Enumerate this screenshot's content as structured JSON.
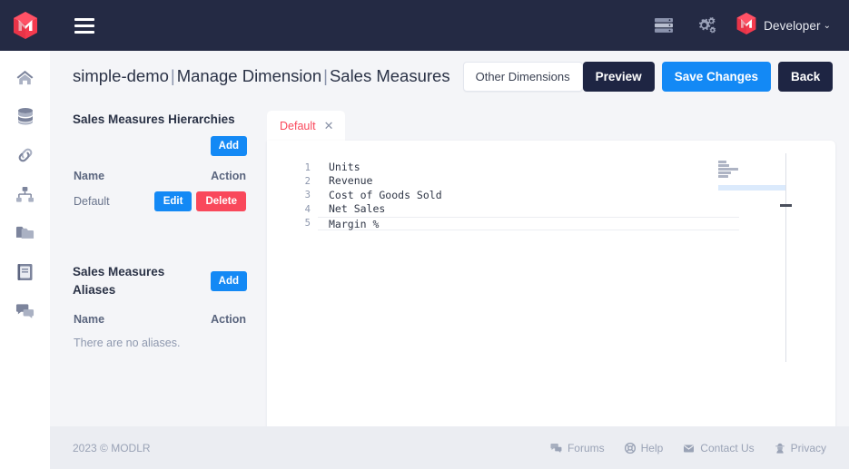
{
  "navbar": {
    "logo_icon": "modlr-logo-icon",
    "menu_icon": "hamburger-menu-icon",
    "server_icon": "server-icon",
    "settings_icon": "cogs-icon",
    "user_logo_icon": "modlr-logo-icon",
    "user_label": "Developer",
    "chevron": "⌄"
  },
  "sidebar": {
    "items": [
      {
        "name": "home",
        "icon": "home-icon"
      },
      {
        "name": "databases",
        "icon": "database-icon"
      },
      {
        "name": "links",
        "icon": "link-icon"
      },
      {
        "name": "hierarchy",
        "icon": "sitemap-icon"
      },
      {
        "name": "folders",
        "icon": "folder-icon"
      },
      {
        "name": "reports",
        "icon": "book-icon"
      },
      {
        "name": "messages",
        "icon": "comments-icon"
      }
    ]
  },
  "header": {
    "model": "simple-demo",
    "section": "Manage Dimension",
    "dimension": "Sales Measures",
    "separator": "|",
    "other_dimensions_label": "Other Dimensions",
    "preview_label": "Preview",
    "save_label": "Save Changes",
    "back_label": "Back"
  },
  "hierarchies": {
    "title": "Sales Measures Hierarchies",
    "add_label": "Add",
    "col_name": "Name",
    "col_action": "Action",
    "rows": [
      {
        "name": "Default",
        "edit_label": "Edit",
        "delete_label": "Delete"
      }
    ]
  },
  "aliases": {
    "title": "Sales Measures Aliases",
    "add_label": "Add",
    "col_name": "Name",
    "col_action": "Action",
    "empty_text": "There are no aliases."
  },
  "editor": {
    "tab_label": "Default",
    "close_icon": "close-icon",
    "lines": [
      {
        "number": "1",
        "text": "Units"
      },
      {
        "number": "2",
        "text": "Revenue"
      },
      {
        "number": "3",
        "text": "Cost of Goods Sold"
      },
      {
        "number": "4",
        "text": "Net Sales"
      },
      {
        "number": "5",
        "text": "Margin %"
      }
    ]
  },
  "footer": {
    "copyright": "2023 © MODLR",
    "links": [
      {
        "label": "Forums",
        "icon": "comments-icon"
      },
      {
        "label": "Help",
        "icon": "life-ring-icon"
      },
      {
        "label": "Contact Us",
        "icon": "envelope-icon"
      },
      {
        "label": "Privacy",
        "icon": "user-secret-icon"
      }
    ]
  },
  "colors": {
    "navbar": "#242a44",
    "accent_blue": "#1389f5",
    "danger_red": "#f9485b",
    "brand_red": "#f43a4e",
    "dark_button": "#1e2543",
    "page_bg": "#f4f5f8",
    "footer_bg": "#ebedf2"
  }
}
